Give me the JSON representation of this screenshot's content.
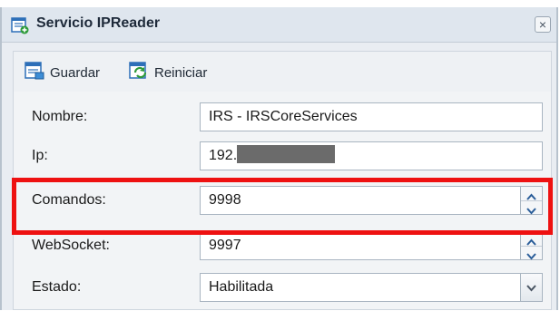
{
  "window": {
    "title": "Servicio IPReader",
    "title_icon": "service-form-icon",
    "close_icon": "close-icon"
  },
  "toolbar": {
    "save_label": "Guardar",
    "save_icon": "save-icon",
    "restart_label": "Reiniciar",
    "restart_icon": "restart-icon"
  },
  "form": {
    "nombre": {
      "label": "Nombre:",
      "value": "IRS - IRSCoreServices"
    },
    "ip": {
      "label": "Ip:",
      "value": "192."
    },
    "comandos": {
      "label": "Comandos:",
      "value": "9998"
    },
    "websocket": {
      "label": "WebSocket:",
      "value": "9997"
    },
    "estado": {
      "label": "Estado:",
      "value": "Habilitada"
    }
  },
  "colors": {
    "highlight": "#ee1111",
    "title_bg": "#dfe6ee",
    "icon_blue": "#2d6fb8",
    "icon_green": "#2e9b3a"
  }
}
